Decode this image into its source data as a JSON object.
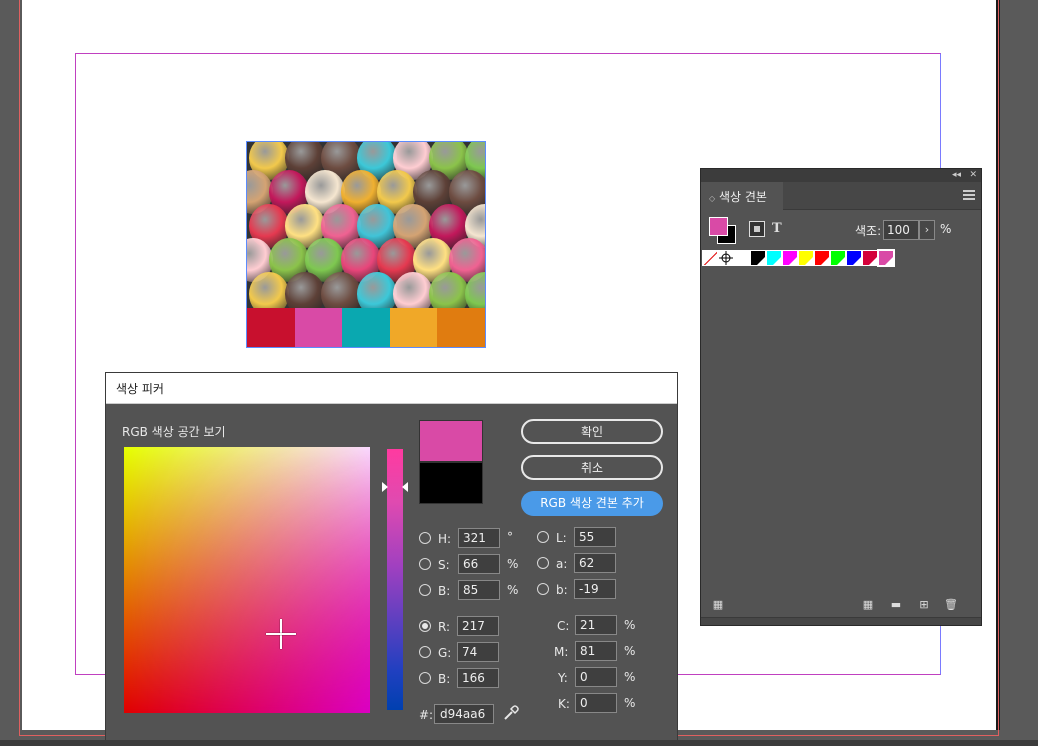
{
  "picker": {
    "title": "색상 피커",
    "space_label": "RGB  색상  공간  보기",
    "ok_label": "확인",
    "cancel_label": "취소",
    "add_swatch_label": "RGB  색상  견본  추가",
    "new_color": "#d94aa6",
    "old_color": "#000000",
    "hsb": [
      {
        "label": "H:",
        "value": "321",
        "unit": "°",
        "selected": false
      },
      {
        "label": "S:",
        "value": "66",
        "unit": "%",
        "selected": false
      },
      {
        "label": "B:",
        "value": "85",
        "unit": "%",
        "selected": false
      }
    ],
    "lab": [
      {
        "label": "L:",
        "value": "55",
        "selected": false
      },
      {
        "label": "a:",
        "value": "62",
        "selected": false
      },
      {
        "label": "b:",
        "value": "-19",
        "selected": false
      }
    ],
    "rgb": [
      {
        "label": "R:",
        "value": "217",
        "selected": true
      },
      {
        "label": "G:",
        "value": "74",
        "selected": false
      },
      {
        "label": "B:",
        "value": "166",
        "selected": false
      }
    ],
    "cmyk": [
      {
        "label": "C:",
        "value": "21",
        "unit": "%"
      },
      {
        "label": "M:",
        "value": "81",
        "unit": "%"
      },
      {
        "label": "Y:",
        "value": "0",
        "unit": "%"
      },
      {
        "label": "K:",
        "value": "0",
        "unit": "%"
      }
    ],
    "hex_label": "#:",
    "hex_value": "d94aa6"
  },
  "swatches_panel": {
    "tab_label": "색상 견본",
    "collapse_glyph": "◂◂",
    "close_glyph": "✕",
    "text_glyph": "T",
    "tint_label": "색조:",
    "tint_value": "100",
    "tint_arrow": "›",
    "tint_unit": "%",
    "fill_color": "#d94aa6",
    "stroke_color": "#000000",
    "swatches": [
      {
        "name": "none",
        "color": "#ffffff"
      },
      {
        "name": "registration",
        "color": "#ffffff"
      },
      {
        "name": "paper",
        "color": "#ffffff"
      },
      {
        "name": "black",
        "color": "#000000"
      },
      {
        "name": "cyan",
        "color": "#00ffff"
      },
      {
        "name": "magenta",
        "color": "#ff00ff"
      },
      {
        "name": "yellow",
        "color": "#ffff00"
      },
      {
        "name": "red",
        "color": "#ff0000"
      },
      {
        "name": "green",
        "color": "#00ff00"
      },
      {
        "name": "blue",
        "color": "#0000ff"
      },
      {
        "name": "dark-red",
        "color": "#d4003a"
      },
      {
        "name": "pink",
        "color": "#d94aa6"
      }
    ],
    "bottom_icons": [
      "swatch-view-icon",
      "grid-view-icon",
      "folder-icon",
      "new-swatch-icon",
      "trash-icon"
    ]
  },
  "document": {
    "palette_colors": [
      "#c8102e",
      "#d94aa6",
      "#0aa8b0",
      "#f0a828",
      "#e07c10"
    ]
  }
}
